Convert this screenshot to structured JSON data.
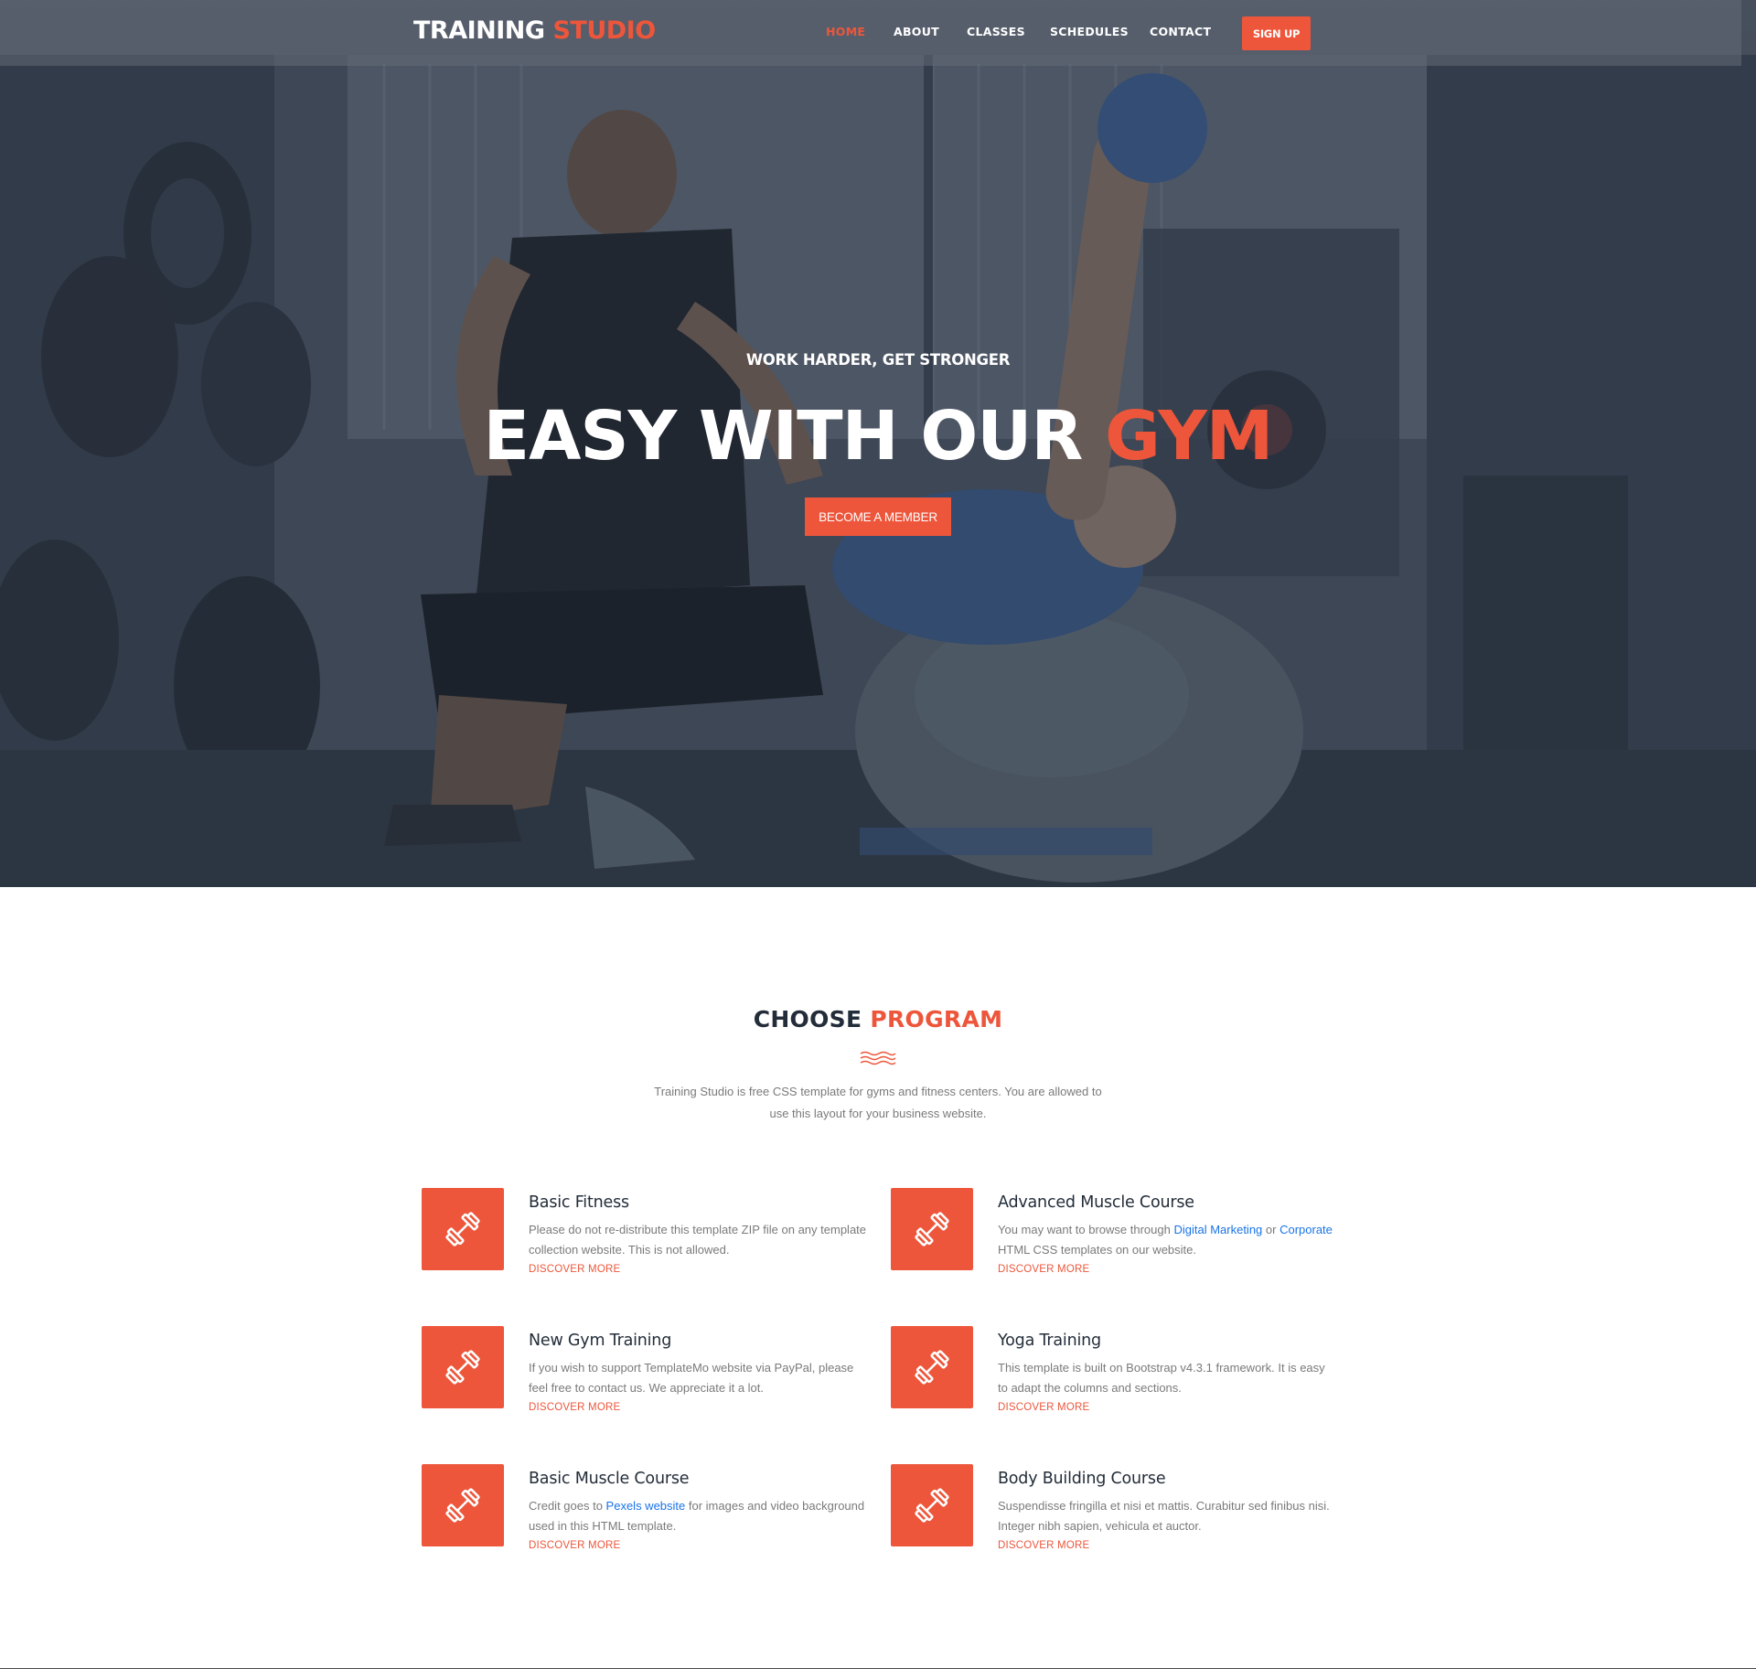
{
  "colors": {
    "accent": "#ed563b",
    "dark": "#232d39",
    "muted": "#7a7a7a",
    "link": "#1a73e8"
  },
  "header": {
    "logo_main": "TRAINING",
    "logo_accent": "STUDIO",
    "nav": [
      {
        "label": "HOME",
        "active": true
      },
      {
        "label": "ABOUT",
        "active": false
      },
      {
        "label": "CLASSES",
        "active": false
      },
      {
        "label": "SCHEDULES",
        "active": false
      },
      {
        "label": "CONTACT",
        "active": false
      }
    ],
    "signup_label": "SIGN UP"
  },
  "hero": {
    "kicker": "WORK HARDER, GET STRONGER",
    "title_main": "EASY WITH OUR",
    "title_accent": "GYM",
    "cta_label": "BECOME A MEMBER"
  },
  "programs_section": {
    "title_main": "CHOOSE",
    "title_accent": "PROGRAM",
    "description": "Training Studio is free CSS template for gyms and fitness centers. You are allowed to use this layout for your business website.",
    "items": [
      {
        "title": "Basic Fitness",
        "desc_parts": [
          "Please do not re-distribute this template ZIP file on any template collection website. This is not allowed."
        ],
        "links": [],
        "more_label": "DISCOVER MORE",
        "icon": "dumbbell-icon"
      },
      {
        "title": "Advanced Muscle Course",
        "desc_parts": [
          "You may want to browse through ",
          " or ",
          " HTML CSS templates on our website."
        ],
        "links": [
          "Digital Marketing",
          "Corporate"
        ],
        "more_label": "DISCOVER MORE",
        "icon": "dumbbell-icon"
      },
      {
        "title": "New Gym Training",
        "desc_parts": [
          "If you wish to support TemplateMo website via PayPal, please feel free to contact us. We appreciate it a lot."
        ],
        "links": [],
        "more_label": "DISCOVER MORE",
        "icon": "dumbbell-icon"
      },
      {
        "title": "Yoga Training",
        "desc_parts": [
          "This template is built on Bootstrap v4.3.1 framework. It is easy to adapt the columns and sections."
        ],
        "links": [],
        "more_label": "DISCOVER MORE",
        "icon": "dumbbell-icon"
      },
      {
        "title": "Basic Muscle Course",
        "desc_parts": [
          "Credit goes to ",
          " for images and video background used in this HTML template."
        ],
        "links": [
          "Pexels website"
        ],
        "more_label": "DISCOVER MORE",
        "icon": "dumbbell-icon"
      },
      {
        "title": "Body Building Course",
        "desc_parts": [
          "Suspendisse fringilla et nisi et mattis. Curabitur sed finibus nisi. Integer nibh sapien, vehicula et auctor."
        ],
        "links": [],
        "more_label": "DISCOVER MORE",
        "icon": "dumbbell-icon"
      }
    ]
  }
}
